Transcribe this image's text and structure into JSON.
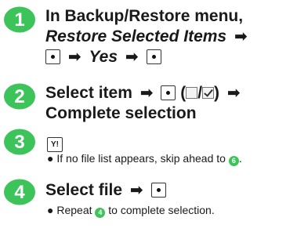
{
  "colors": {
    "badge": "#3cc35a",
    "badge_text": "#ffffff"
  },
  "icons": {
    "center_key": "center-key-icon",
    "arrow": "right-arrow-icon",
    "y_key": "y-key-icon"
  },
  "steps": [
    {
      "number": "1",
      "line1": "In Backup/Restore menu,",
      "line2_item": "Restore Selected Items",
      "line3_item": "Yes"
    },
    {
      "number": "2",
      "line1_text": "Select item",
      "paren_open": "(",
      "slash": "/",
      "paren_close": ")",
      "line2": "Complete selection"
    },
    {
      "number": "3",
      "key_label": "Y!",
      "note": "If no file list appears, skip ahead to",
      "note_ref": "6",
      "note_end": "."
    },
    {
      "number": "4",
      "line1_text": "Select file",
      "note_start": "Repeat",
      "note_ref": "4",
      "note_end": "to complete selection."
    }
  ]
}
